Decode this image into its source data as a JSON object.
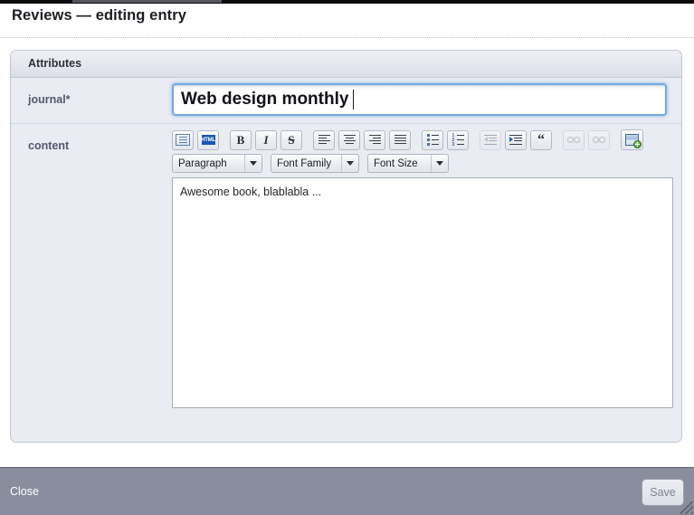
{
  "window": {
    "chrome_present": true
  },
  "dialog": {
    "title": "Reviews — editing entry"
  },
  "panel": {
    "header_title": "Attributes"
  },
  "fields": {
    "journal": {
      "label": "journal*",
      "value": "Web design monthly",
      "placeholder": ""
    },
    "content": {
      "label": "content",
      "body_text": "Awesome book, blablabla ..."
    }
  },
  "editor_toolbar": {
    "buttons": [
      {
        "name": "source-view-icon",
        "title": "Source view",
        "enabled": true
      },
      {
        "name": "html-icon",
        "title": "HTML",
        "enabled": true
      },
      {
        "name": "bold-icon",
        "title": "Bold",
        "glyph": "B",
        "enabled": true
      },
      {
        "name": "italic-icon",
        "title": "Italic",
        "glyph": "I",
        "enabled": true
      },
      {
        "name": "strikethrough-icon",
        "title": "Strikethrough",
        "glyph": "S",
        "enabled": true
      },
      {
        "name": "align-left-icon",
        "title": "Align left",
        "enabled": true
      },
      {
        "name": "align-center-icon",
        "title": "Align center",
        "enabled": true
      },
      {
        "name": "align-right-icon",
        "title": "Align right",
        "enabled": true
      },
      {
        "name": "align-justify-icon",
        "title": "Justify",
        "enabled": true
      },
      {
        "name": "bullet-list-icon",
        "title": "Bullet list",
        "enabled": true
      },
      {
        "name": "numbered-list-icon",
        "title": "Numbered list",
        "enabled": true
      },
      {
        "name": "outdent-icon",
        "title": "Outdent",
        "enabled": false
      },
      {
        "name": "indent-icon",
        "title": "Indent",
        "enabled": true
      },
      {
        "name": "blockquote-icon",
        "title": "Blockquote",
        "glyph": "“",
        "enabled": true
      },
      {
        "name": "link-icon",
        "title": "Insert link",
        "enabled": false
      },
      {
        "name": "unlink-icon",
        "title": "Remove link",
        "enabled": false
      },
      {
        "name": "insert-image-icon",
        "title": "Insert image",
        "enabled": true
      }
    ],
    "numbered_list_digits": [
      "1",
      "2",
      "3"
    ],
    "selects": [
      {
        "name": "paragraph-format-select",
        "value": "Paragraph"
      },
      {
        "name": "font-family-select",
        "value": "Font Family"
      },
      {
        "name": "font-size-select",
        "value": "Font Size"
      }
    ]
  },
  "footer": {
    "close_label": "Close",
    "save_label": "Save"
  },
  "colors": {
    "panel_background": "#e9ecf3",
    "panel_border": "#c3c7d1",
    "focus_blue": "#74a9de",
    "footer_background": "#898e9e",
    "label_text": "#55596a",
    "title_text": "#1b1d22",
    "accent_green": "#3c8c27",
    "html_icon_blue": "#1857b4"
  }
}
